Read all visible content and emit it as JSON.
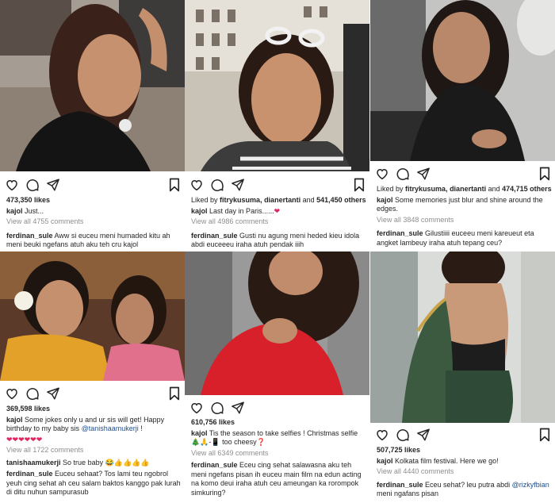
{
  "posts": [
    {
      "likes": "473,350 likes",
      "caption_user": "kajol",
      "caption": "Just...",
      "view_comments": "View all 4755 comments",
      "comment_user": "ferdinan_sule",
      "comment": "Aww si euceu meni humaded kitu ah meni beuki ngefans atuh aku teh cru kajol"
    },
    {
      "liked_by_prefix": "Liked by",
      "liked_by_user": "fitrykusuma, dianertanti",
      "liked_by_mid": "and",
      "liked_by_count": "541,450 others",
      "caption_user": "kajol",
      "caption": "Last day in Paris......",
      "caption_emoji": "❤",
      "view_comments": "View all 4986 comments",
      "comment_user": "ferdinan_sule",
      "comment": "Gusti nu agung meni heded kieu idola abdi euceeeu iraha atuh pendak iiih"
    },
    {
      "liked_by_prefix": "Liked by",
      "liked_by_user": "fitrykusuma, dianertanti",
      "liked_by_mid": "and",
      "liked_by_count": "474,715 others",
      "caption_user": "kajol",
      "caption": "Some memories just blur and shine around the edges.",
      "view_comments": "View all 3848 comments",
      "comment_user": "ferdinan_sule",
      "comment": "Gilustiiii euceeu meni kareueut eta angket lambeuy iraha atuh tepang ceu?"
    },
    {
      "likes": "369,598 likes",
      "caption_user": "kajol",
      "caption": "Some jokes only u and ur sis will get! Happy birthday to my baby sis",
      "caption_mention": "@tanishaamukerji",
      "caption_end": "!",
      "caption_hearts": "❤❤❤❤❤❤",
      "view_comments": "View all 1722 comments",
      "comment1_user": "tanishaamukerji",
      "comment1": "So true baby 😂👍👍👍👍",
      "comment_user": "ferdinan_sule",
      "comment": "Euceu sehaat? Tos lami teu ngobrol yeuh cing sehat ah ceu salam baktos kanggo pak lurah di ditu nuhun sampurasub"
    },
    {
      "likes": "610,756 likes",
      "caption_user": "kajol",
      "caption": "Tis the season to take selfies ! Christmas selfie 🎄🙏-📱 too cheesy❓",
      "view_comments": "View all 6349 comments",
      "comment_user": "ferdinan_sule",
      "comment": "Eceu cing sehat salawasna aku teh meni ngefans pisan ih euceu main film na edun acting na komo deui iraha atuh ceu ameungan ka rorompok simkuring?"
    },
    {
      "likes": "507,725 likes",
      "caption_user": "kajol",
      "caption": "Kolkata film festival. Here we go!",
      "view_comments": "View all 4440 comments",
      "comment_user": "ferdinan_sule",
      "comment": "Eceu sehat? leu putra abdi",
      "comment_mention": "@rizkyfbian",
      "comment_end": "meni ngafans pisan"
    }
  ],
  "colors": {
    "text": "#262626",
    "muted": "#8e8e8e",
    "mention": "#1d4f91",
    "heart": "#e0245e"
  },
  "icons": [
    "heart-icon",
    "comment-icon",
    "share-icon",
    "bookmark-icon"
  ]
}
